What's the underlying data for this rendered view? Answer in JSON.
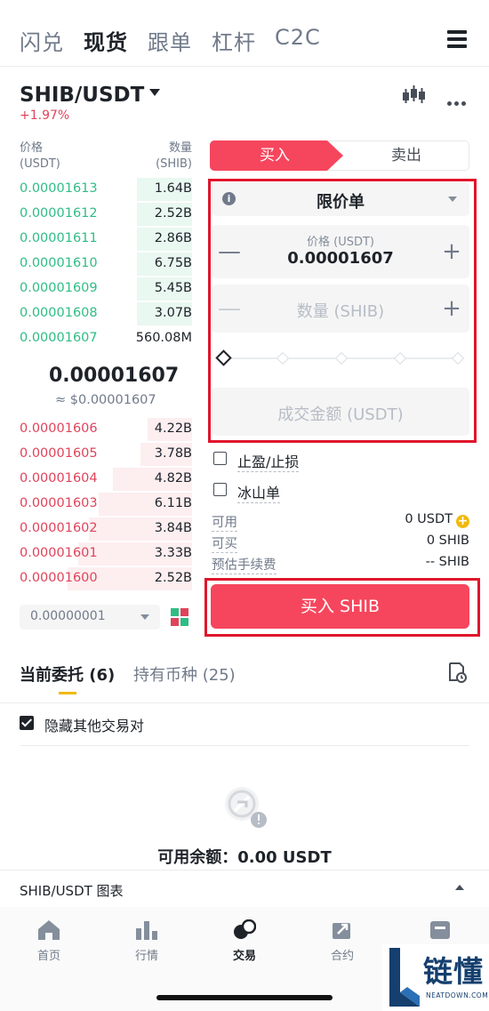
{
  "top_tabs": [
    "闪兑",
    "现货",
    "跟单",
    "杠杆",
    "C2C"
  ],
  "pair": {
    "name": "SHIB/USDT",
    "change": "+1.97%"
  },
  "order_book": {
    "price_header": "价格",
    "price_unit": "(USDT)",
    "qty_header": "数量",
    "qty_unit": "(SHIB)",
    "bids": [
      {
        "price": "0.00001613",
        "qty": "1.64B",
        "depth": 0.32
      },
      {
        "price": "0.00001612",
        "qty": "2.52B",
        "depth": 0.32
      },
      {
        "price": "0.00001611",
        "qty": "2.86B",
        "depth": 0.32
      },
      {
        "price": "0.00001610",
        "qty": "6.75B",
        "depth": 0.32
      },
      {
        "price": "0.00001609",
        "qty": "5.45B",
        "depth": 0.32
      },
      {
        "price": "0.00001608",
        "qty": "3.07B",
        "depth": 0.32
      },
      {
        "price": "0.00001607",
        "qty": "560.08M",
        "depth": 0.0
      }
    ],
    "last_price": "0.00001607",
    "last_price_usd": "≈ $0.00001607",
    "asks": [
      {
        "price": "0.00001606",
        "qty": "4.22B",
        "depth": 0.26
      },
      {
        "price": "0.00001605",
        "qty": "3.78B",
        "depth": 0.3
      },
      {
        "price": "0.00001604",
        "qty": "4.82B",
        "depth": 0.46
      },
      {
        "price": "0.00001603",
        "qty": "6.11B",
        "depth": 0.54
      },
      {
        "price": "0.00001602",
        "qty": "3.84B",
        "depth": 0.6
      },
      {
        "price": "0.00001601",
        "qty": "3.33B",
        "depth": 0.66
      },
      {
        "price": "0.00001600",
        "qty": "2.52B",
        "depth": 0.72
      }
    ],
    "depth_value": "0.00000001"
  },
  "trade_form": {
    "buy_label": "买入",
    "sell_label": "卖出",
    "order_type": "限价单",
    "price_label": "价格 (USDT)",
    "price_value": "0.00001607",
    "qty_placeholder": "数量 (SHIB)",
    "total_placeholder": "成交金额 (USDT)",
    "tp_sl": "止盈/止损",
    "iceberg": "冰山单",
    "available_label": "可用",
    "available_value": "0 USDT",
    "can_buy_label": "可买",
    "can_buy_value": "0 SHIB",
    "fee_label": "预估手续费",
    "fee_value": "-- SHIB",
    "buy_button": "买入 SHIB"
  },
  "orders": {
    "tab_open": "当前委托 (6)",
    "tab_holdings": "持有币种 (25)",
    "hide_others": "隐藏其他交易对",
    "balance": "可用余额：0.00 USDT",
    "chart_label": "SHIB/USDT 图表"
  },
  "bottom_nav": [
    "首页",
    "行情",
    "交易",
    "合约",
    "资产"
  ],
  "watermark": {
    "text": "链懂",
    "sub": "NEATDOWN.COM"
  },
  "colors": {
    "buy": "#2ebd85",
    "sell": "#e0435a",
    "accent": "#f0b90b",
    "buy_button": "#f6465d"
  }
}
